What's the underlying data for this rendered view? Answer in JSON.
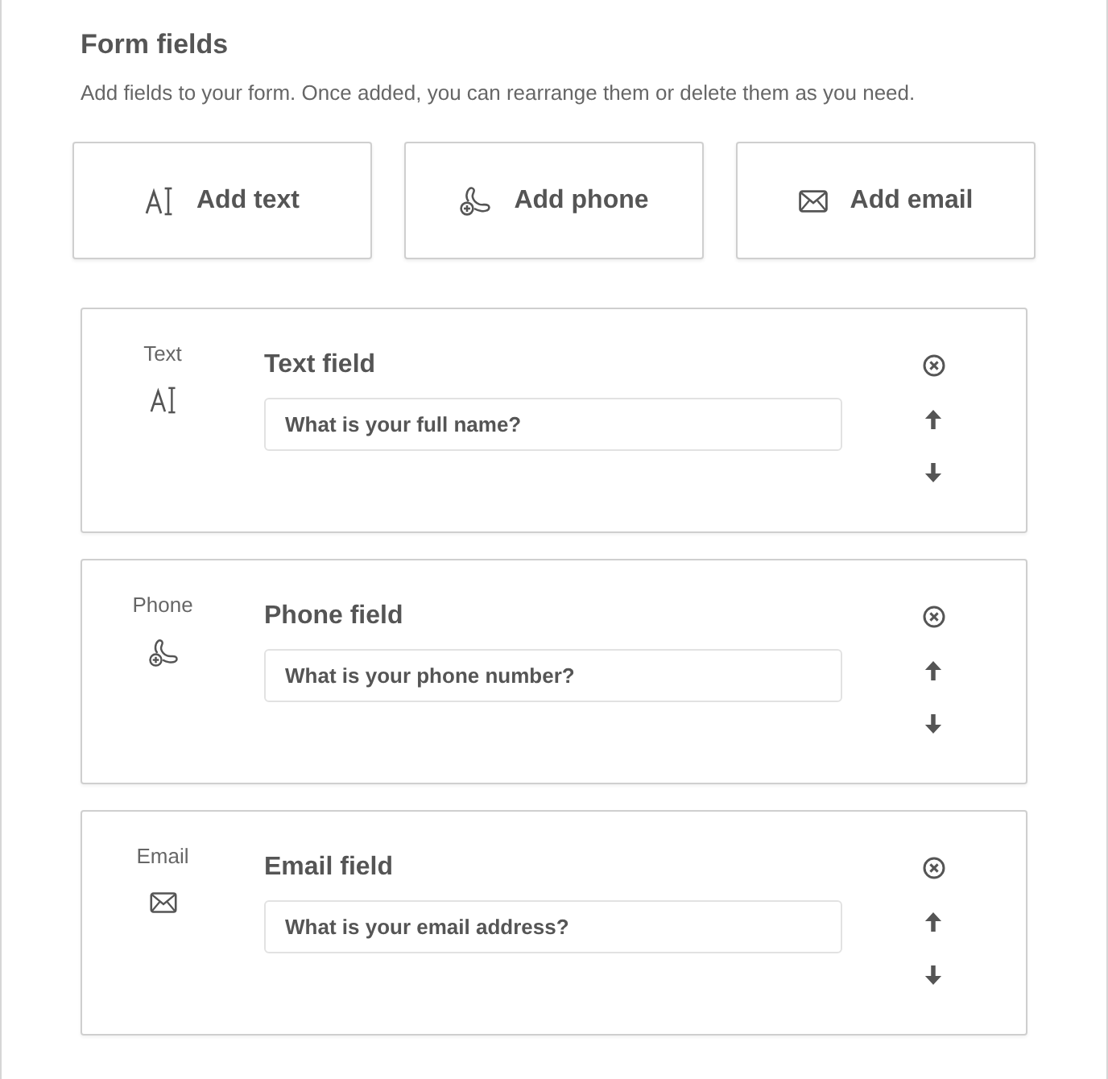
{
  "section": {
    "title": "Form fields",
    "description": "Add fields to your form. Once added, you can rearrange them or delete them as you need."
  },
  "add_buttons": [
    {
      "kind": "text",
      "label": "Add text"
    },
    {
      "kind": "phone",
      "label": "Add phone"
    },
    {
      "kind": "email",
      "label": "Add email"
    }
  ],
  "fields": [
    {
      "kind": "text",
      "type_label": "Text",
      "title": "Text field",
      "value": "What is your full name?"
    },
    {
      "kind": "phone",
      "type_label": "Phone",
      "title": "Phone field",
      "value": "What is your phone number?"
    },
    {
      "kind": "email",
      "type_label": "Email",
      "title": "Email field",
      "value": "What is your email address?"
    }
  ]
}
